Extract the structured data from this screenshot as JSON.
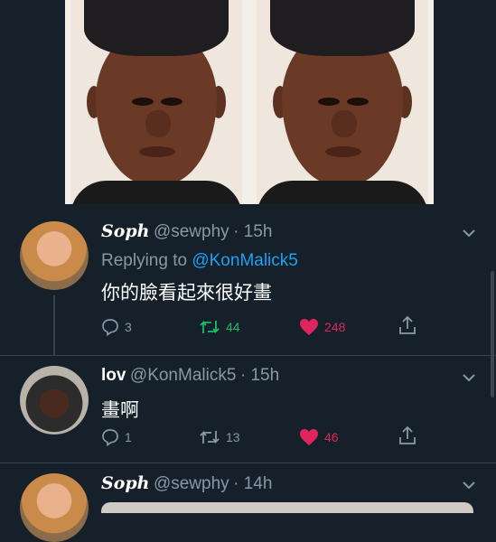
{
  "tweets": [
    {
      "name": "Soph",
      "handle": "@sewphy",
      "time": "· 15h",
      "reply_prefix": "Replying to",
      "reply_to": "@KonMalick5",
      "text": "你的臉看起來很好畫",
      "replies": "3",
      "retweets": "44",
      "likes": "248"
    },
    {
      "name": "lov",
      "handle": "@KonMalick5",
      "time": "· 15h",
      "text": "畫啊",
      "replies": "1",
      "retweets": "13",
      "likes": "46"
    },
    {
      "name": "Soph",
      "handle": "@sewphy",
      "time": "· 14h"
    }
  ],
  "icons": {
    "reply": "reply-icon",
    "retweet": "retweet-icon",
    "like": "heart-icon",
    "share": "share-icon",
    "more": "chevron-down-icon"
  },
  "colors": {
    "background": "#15202b",
    "text_secondary": "#8899a6",
    "link": "#1da1f2",
    "retweet": "#17bf63",
    "like": "#e0245e"
  }
}
